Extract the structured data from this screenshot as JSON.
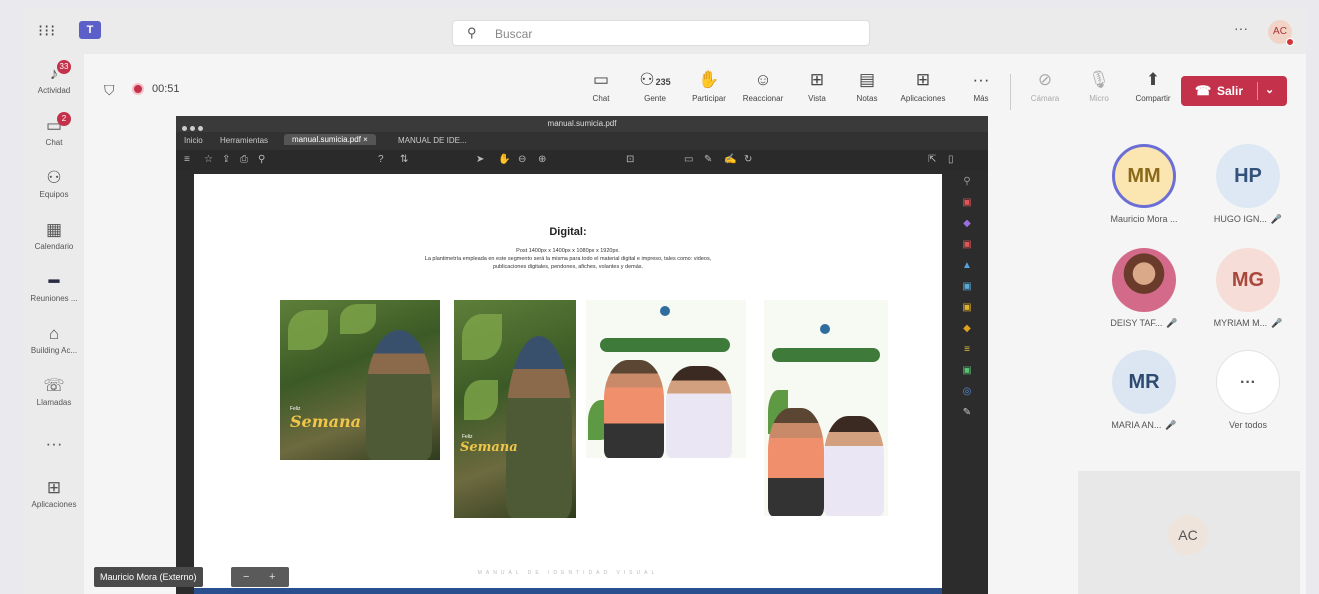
{
  "topbar": {
    "waffle_icon": "app-launcher-icon",
    "search_placeholder": "Buscar",
    "more": "···",
    "avatar": "AC"
  },
  "rail": {
    "items": [
      {
        "label": "Actividad",
        "icon": "bell-icon",
        "badge": "33"
      },
      {
        "label": "Chat",
        "icon": "chat-icon",
        "badge": "2"
      },
      {
        "label": "Equipos",
        "icon": "teams-icon",
        "badge": ""
      },
      {
        "label": "Calendario",
        "icon": "calendar-icon",
        "badge": ""
      },
      {
        "label": "Reuniones ...",
        "icon": "meeting-icon",
        "badge": ""
      },
      {
        "label": "Building Ac...",
        "icon": "building-icon",
        "badge": ""
      },
      {
        "label": "Llamadas",
        "icon": "phone-icon",
        "badge": ""
      },
      {
        "label": "···",
        "icon": "more-icon",
        "badge": ""
      },
      {
        "label": "Aplicaciones",
        "icon": "apps-icon",
        "badge": ""
      }
    ]
  },
  "meeting": {
    "timer": "00:51",
    "toolbar": [
      {
        "label": "Chat",
        "icon": "chat-icon"
      },
      {
        "label": "Gente",
        "icon": "people-icon",
        "count": "235"
      },
      {
        "label": "Participar",
        "icon": "raise-hand-icon"
      },
      {
        "label": "Reaccionar",
        "icon": "emoji-icon"
      },
      {
        "label": "Vista",
        "icon": "view-icon"
      },
      {
        "label": "Notas",
        "icon": "notes-icon"
      },
      {
        "label": "Aplicaciones",
        "icon": "apps-icon"
      },
      {
        "label": "Más",
        "icon": "more-icon"
      }
    ],
    "media": [
      {
        "label": "Cámara",
        "icon": "camera-off-icon"
      },
      {
        "label": "Micro",
        "icon": "mic-off-icon"
      },
      {
        "label": "Compartir",
        "icon": "share-icon"
      }
    ],
    "leave_label": "Salir",
    "leave_color": "#c4314b"
  },
  "share": {
    "window_title": "manual.sumicia.pdf",
    "tabs": [
      "Inicio",
      "Herramientas",
      "manual.sumicia.pdf ×",
      "MANUAL DE IDE..."
    ],
    "doc": {
      "title": "Digital:",
      "line1": "Post 1400px x 1400px x 1080px x 1920px.",
      "line2": "La plantimetría empleada en este segmento será la misma para todo el material digital e impreso, tales como: videos,",
      "line3": "publicaciones digitales, pendones, afiches, volantes y demás.",
      "thumb_word": "Semana",
      "thumb_small": "Feliz",
      "footer": "MANUAL DE IDENTIDAD VISUAL"
    },
    "presenter_tag": "Mauricio Mora (Externo)",
    "zoom_minus": "−",
    "zoom_plus": "+"
  },
  "participants": [
    {
      "initials": "MM",
      "name": "Mauricio Mora ...",
      "muted": false
    },
    {
      "initials": "HP",
      "name": "HUGO IGN...",
      "muted": true
    },
    {
      "initials": "",
      "name": "DEISY TAF...",
      "muted": true
    },
    {
      "initials": "MG",
      "name": "MYRIAM M...",
      "muted": true
    },
    {
      "initials": "MR",
      "name": "MARIA AN...",
      "muted": true
    },
    {
      "initials": "···",
      "name": "Ver todos",
      "muted": false
    }
  ],
  "self_tile": {
    "initials": "AC"
  }
}
